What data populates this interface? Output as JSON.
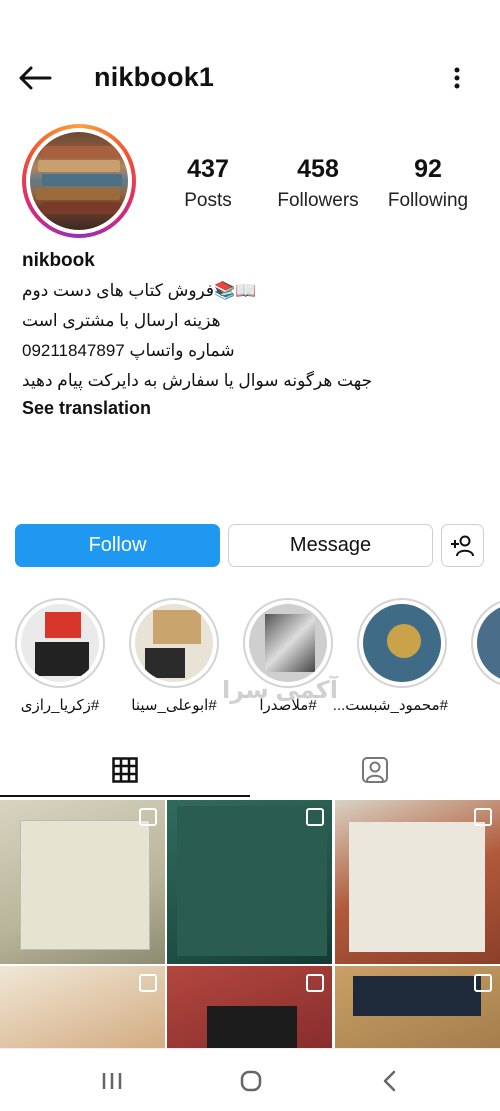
{
  "header": {
    "back_icon": "arrow-left-icon",
    "username": "nikbook1",
    "more_icon": "more-vertical-icon"
  },
  "profile": {
    "stats": [
      {
        "value": "437",
        "label": "Posts"
      },
      {
        "value": "458",
        "label": "Followers"
      },
      {
        "value": "92",
        "label": "Following"
      }
    ],
    "name": "nikbook",
    "bio_lines": [
      "📖📚فروش کتاب های دست دوم",
      "هزینه ارسال با مشتری است",
      "شماره واتساپ 09211847897",
      "جهت هرگونه سوال یا سفارش به دایرکت پیام دهید"
    ],
    "see_translation": "See translation"
  },
  "actions": {
    "follow": "Follow",
    "message": "Message",
    "suggest_icon": "add-person-icon"
  },
  "highlights": [
    {
      "label": "#زکریا_رازی"
    },
    {
      "label": "#ابوعلی_سینا"
    },
    {
      "label": "#ملاصدرا"
    },
    {
      "label": "#محمود_شبست..."
    },
    {
      "label": "#..."
    }
  ],
  "tabs": [
    {
      "name": "grid",
      "icon": "grid-icon"
    },
    {
      "name": "tagged",
      "icon": "tagged-person-icon"
    }
  ],
  "watermark": "آکمی سرا",
  "colors": {
    "follow_blue": "#1f98f2",
    "ring_gradient_start": "#f9a33b",
    "ring_gradient_end": "#962fbf"
  },
  "navbar": {
    "recent_icon": "recent-apps-icon",
    "home_icon": "home-icon",
    "back_icon": "back-chevron-icon"
  }
}
